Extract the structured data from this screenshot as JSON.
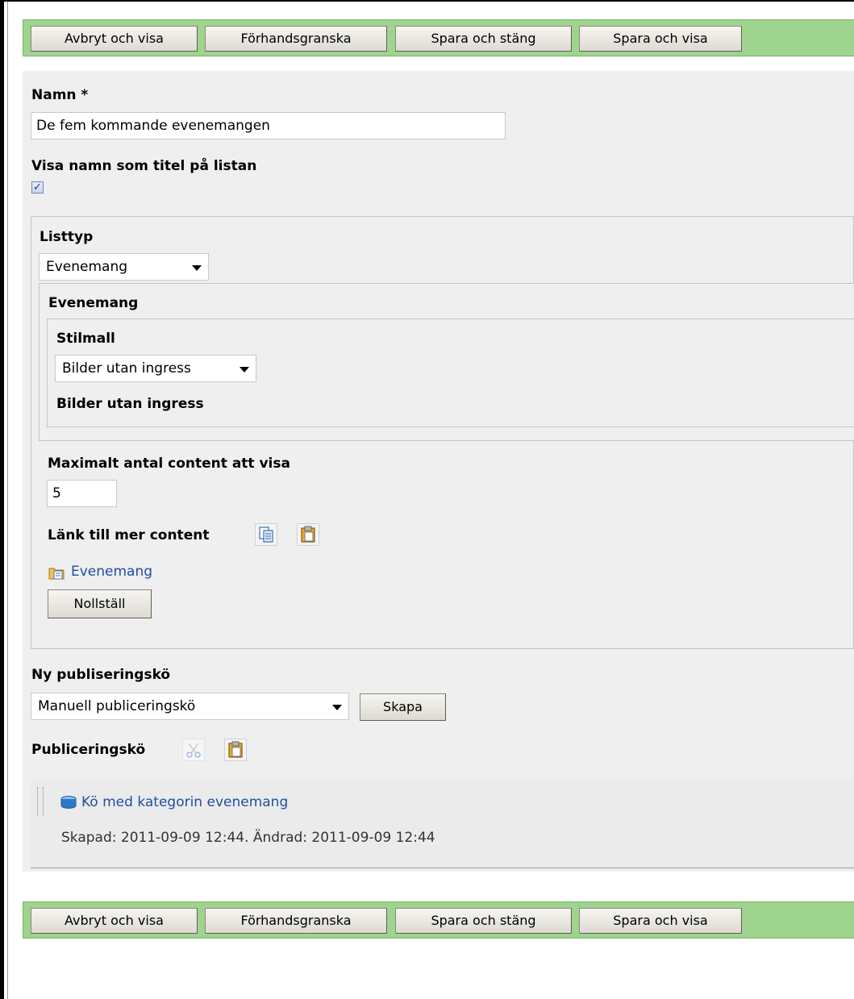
{
  "toolbar": {
    "cancel_view": "Avbryt och visa",
    "preview": "Förhandsgranska",
    "save_close": "Spara och stäng",
    "save_view": "Spara och visa"
  },
  "form": {
    "name_label": "Namn *",
    "name_value": "De fem kommande evenemangen",
    "show_title_label": "Visa namn som titel på listan",
    "show_title_checked": true,
    "list_type_label": "Listtyp",
    "list_type_value": "Evenemang",
    "events_heading": "Evenemang",
    "style_label": "Stilmall",
    "style_value": "Bilder utan ingress",
    "style_heading": "Bilder utan ingress",
    "max_label": "Maximalt antal content att visa",
    "max_value": "5",
    "more_link_label": "Länk till mer content",
    "more_link_target": "Evenemang",
    "reset_label": "Nollställ",
    "new_queue_label": "Ny publiseringskö",
    "new_queue_value": "Manuell publiceringskö",
    "create_label": "Skapa",
    "queue_label": "Publiceringskö",
    "queue_item_name": "Kö med kategorin evenemang",
    "queue_item_meta": "Skapad: 2011-09-09 12:44. Ändrad: 2011-09-09 12:44"
  },
  "icons": {
    "copy": "copy-icon",
    "paste": "paste-icon",
    "cut": "cut-icon",
    "folder_link": "folder-link-icon",
    "queue": "queue-icon",
    "drag_handle": "drag-handle-icon"
  },
  "colors": {
    "toolbar_bg": "#9fd48f",
    "form_bg": "#efefef",
    "link": "#1f4fa3"
  }
}
